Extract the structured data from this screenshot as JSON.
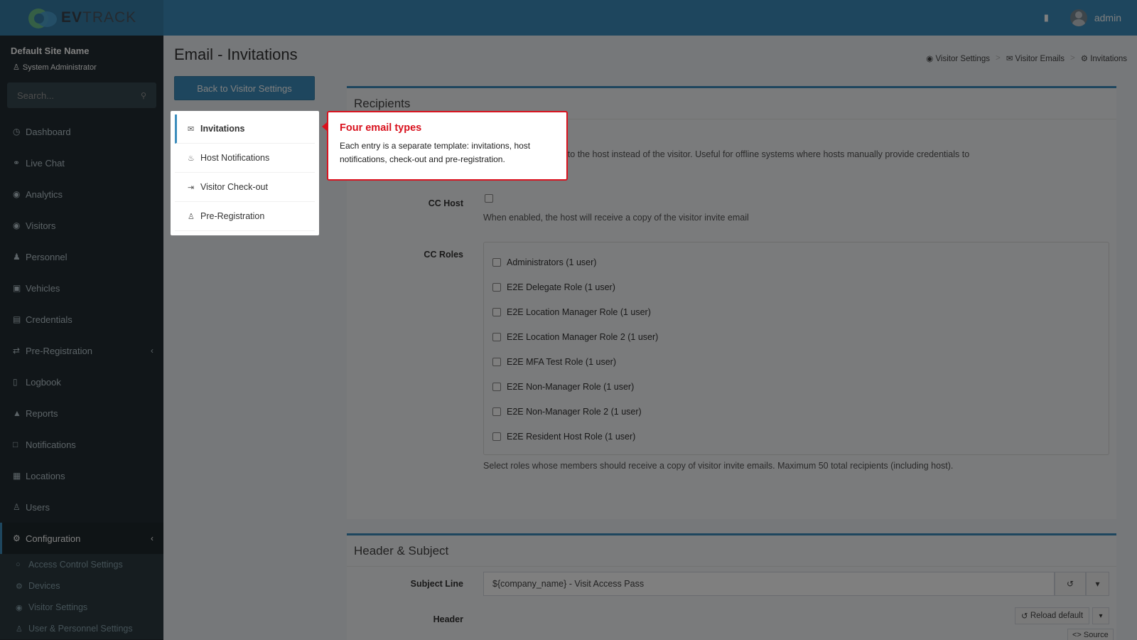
{
  "brand": {
    "name_bold": "EV",
    "name_rest": "TRACK"
  },
  "topbar": {
    "user": "admin",
    "building_icon": "building-icon"
  },
  "sidebar": {
    "site_name": "Default Site Name",
    "role": "System Administrator",
    "search_placeholder": "Search...",
    "items": [
      {
        "label": "Dashboard",
        "icon": "dashboard-icon"
      },
      {
        "label": "Live Chat",
        "icon": "headset-icon"
      },
      {
        "label": "Analytics",
        "icon": "target-icon"
      },
      {
        "label": "Visitors",
        "icon": "eye-icon"
      },
      {
        "label": "Personnel",
        "icon": "users-icon"
      },
      {
        "label": "Vehicles",
        "icon": "car-icon"
      },
      {
        "label": "Credentials",
        "icon": "id-card-icon"
      },
      {
        "label": "Pre-Registration",
        "icon": "arrows-icon"
      },
      {
        "label": "Logbook",
        "icon": "book-icon"
      },
      {
        "label": "Reports",
        "icon": "chart-icon"
      },
      {
        "label": "Notifications",
        "icon": "bell-icon"
      },
      {
        "label": "Locations",
        "icon": "map-icon"
      },
      {
        "label": "Users",
        "icon": "user-icon"
      },
      {
        "label": "Configuration",
        "icon": "gear-icon"
      }
    ],
    "sub_items": [
      {
        "label": "Access Control Settings",
        "icon": "lock-icon"
      },
      {
        "label": "Devices",
        "icon": "cog-icon"
      },
      {
        "label": "Visitor Settings",
        "icon": "eye-icon"
      },
      {
        "label": "User & Personnel Settings",
        "icon": "user-icon"
      }
    ]
  },
  "page": {
    "title": "Email - Invitations",
    "back_button": "Back to Visitor Settings",
    "breadcrumb": [
      "Visitor Settings",
      "Visitor Emails",
      "Invitations"
    ]
  },
  "email_menu": [
    "Invitations",
    "Host Notifications",
    "Visitor Check-out",
    "Pre-Registration"
  ],
  "callout": {
    "title": "Four email types",
    "body": "Each entry is a separate template: invitations, host notifications, check-out and pre-registration."
  },
  "recipients": {
    "title": "Recipients",
    "desc_partial": "ation emails are sent to the host instead of the visitor. Useful for offline systems where hosts manually provide credentials to",
    "cc_host_label": "CC Host",
    "cc_host_help": "When enabled, the host will receive a copy of the visitor invite email",
    "cc_roles_label": "CC Roles",
    "roles": [
      "Administrators (1 user)",
      "E2E Delegate Role (1 user)",
      "E2E Location Manager Role (1 user)",
      "E2E Location Manager Role 2 (1 user)",
      "E2E MFA Test Role (1 user)",
      "E2E Non-Manager Role (1 user)",
      "E2E Non-Manager Role 2 (1 user)",
      "E2E Resident Host Role (1 user)"
    ],
    "roles_help": "Select roles whose members should receive a copy of visitor invite emails. Maximum 50 total recipients (including host)."
  },
  "header_subject": {
    "title": "Header & Subject",
    "subject_label": "Subject Line",
    "subject_value": "${company_name} - Visit Access Pass",
    "header_label": "Header",
    "reload_label": "Reload default",
    "source_label": "<> Source"
  }
}
